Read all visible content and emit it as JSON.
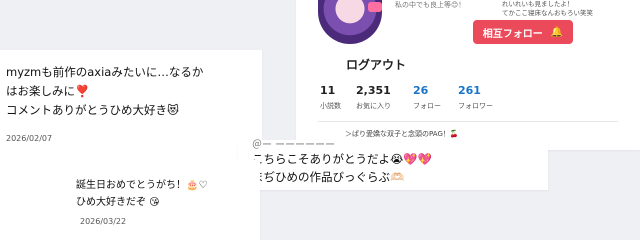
{
  "profile": {
    "caption_small": "私の中でも良上等😊！",
    "caption_right_line1": "れいれいも見ましたよ！",
    "caption_right_line2": "てかここ寝床なんおもろい笑笑",
    "follow_label": "相互フォロー",
    "follow_icon": "bell-icon",
    "username": "ログアウト",
    "stats": [
      {
        "value": "11",
        "label": "小説数"
      },
      {
        "value": "2,351",
        "label": "お気に入り"
      },
      {
        "value": "26",
        "label": "フォロー"
      },
      {
        "value": "261",
        "label": "フォロワー"
      }
    ],
    "bio": "＞ぱり愛嬌な双子と念頭のPAG！🍒"
  },
  "comment1": {
    "line1": "myzmも前作のaxiaみたいに…なるか",
    "line2": "はお楽しみに❣️",
    "line3": "コメントありがとうひめ大好き😻",
    "date": "2026/02/07"
  },
  "reply": {
    "top": "＠ー ーーーーーー",
    "line1": "こちらこそありがとうだよ😭💖💖",
    "line2": "まぢひめの作品びっぐらぶ🫶🏻"
  },
  "comment2": {
    "line1": "誕生日おめでとうがち！🎂♡",
    "line2": "ひめ大好きだぞ 😘",
    "date": "2026/03/22"
  },
  "colors": {
    "accent": "#ea4a5a",
    "blue_stat": "#1a74c9",
    "background": "#eef0f4"
  }
}
